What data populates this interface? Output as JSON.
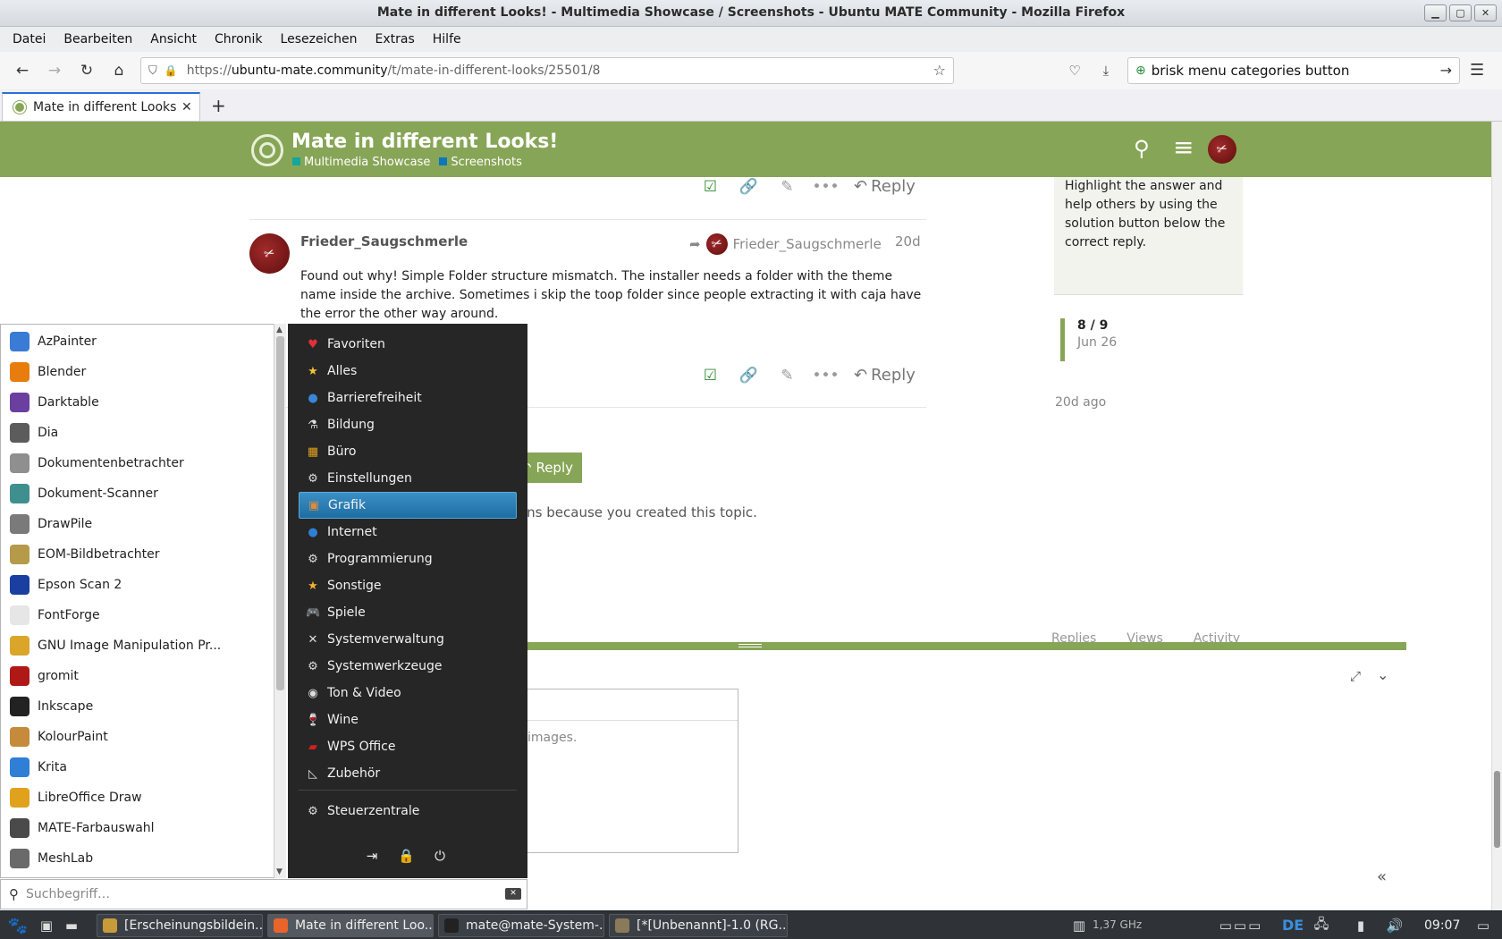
{
  "window": {
    "title": "Mate in different Looks! - Multimedia Showcase / Screenshots - Ubuntu MATE Community - Mozilla Firefox"
  },
  "menubar": {
    "items": [
      "Datei",
      "Bearbeiten",
      "Ansicht",
      "Chronik",
      "Lesezeichen",
      "Extras",
      "Hilfe"
    ]
  },
  "urlbar": {
    "url_prefix": "https://",
    "url_host": "ubuntu-mate.community",
    "url_path": "/t/mate-in-different-looks/25501/8"
  },
  "searchbar": {
    "value": "brisk menu categories button"
  },
  "tabs": [
    {
      "label": "Mate in different Looks!"
    }
  ],
  "topic": {
    "title": "Mate in different Looks!",
    "categories": [
      {
        "name": "Multimedia Showcase",
        "color": "#12a89d"
      },
      {
        "name": "Screenshots",
        "color": "#0e76bd"
      }
    ]
  },
  "post_actions": {
    "reply_label": "Reply"
  },
  "post": {
    "username": "Frieder_Saugschmerle",
    "reply_to": "Frieder_Saugschmerle",
    "date": "20d",
    "body": "Found out why! Simple Folder structure mismatch. The installer needs a folder with the theme name inside the archive. Sometimes i skip the toop folder since people extracting it with caja have the error the other way around."
  },
  "sidebar": {
    "solution_hint": "Highlight the answer and help others by using the solution button below the correct reply.",
    "timeline_position": "8 / 9",
    "timeline_date": "Jun 26",
    "timeline_ago": "20d ago"
  },
  "topic_footer": {
    "reply_button": "Reply",
    "notification_text": "ons because you created this topic.",
    "columns": [
      "Replies",
      "Views",
      "Activity"
    ]
  },
  "composer": {
    "hint": "images."
  },
  "brisk_menu": {
    "apps": [
      {
        "name": "AzPainter",
        "icon": "azpainter-icon",
        "color": "#3a7bd5"
      },
      {
        "name": "Blender",
        "icon": "blender-icon",
        "color": "#e87d0d"
      },
      {
        "name": "Darktable",
        "icon": "darktable-icon",
        "color": "#6a3fa0"
      },
      {
        "name": "Dia",
        "icon": "dia-icon",
        "color": "#5c5c5c"
      },
      {
        "name": "Dokumentenbetrachter",
        "icon": "document-viewer-icon",
        "color": "#8f8f8f"
      },
      {
        "name": "Dokument-Scanner",
        "icon": "scanner-icon",
        "color": "#3f8f8f"
      },
      {
        "name": "DrawPile",
        "icon": "drawpile-icon",
        "color": "#7a7a7a"
      },
      {
        "name": "EOM-Bildbetrachter",
        "icon": "image-viewer-icon",
        "color": "#b59a4a"
      },
      {
        "name": "Epson Scan 2",
        "icon": "epson-scan-icon",
        "color": "#1a3fa0"
      },
      {
        "name": "FontForge",
        "icon": "fontforge-icon",
        "color": "#e6e6e6"
      },
      {
        "name": "GNU Image Manipulation Pr...",
        "icon": "gimp-icon",
        "color": "#d9a62a"
      },
      {
        "name": "gromit",
        "icon": "gromit-icon",
        "color": "#b01818"
      },
      {
        "name": "Inkscape",
        "icon": "inkscape-icon",
        "color": "#222222"
      },
      {
        "name": "KolourPaint",
        "icon": "kolourpaint-icon",
        "color": "#c58a3a"
      },
      {
        "name": "Krita",
        "icon": "krita-icon",
        "color": "#2f7fd6"
      },
      {
        "name": "LibreOffice Draw",
        "icon": "libreoffice-draw-icon",
        "color": "#e0a21c"
      },
      {
        "name": "MATE-Farbauswahl",
        "icon": "color-picker-icon",
        "color": "#4a4a4a"
      },
      {
        "name": "MeshLab",
        "icon": "meshlab-icon",
        "color": "#6a6a6a"
      }
    ],
    "categories": [
      {
        "name": "Favoriten",
        "icon": "heart-icon",
        "glyph": "♥",
        "color": "#e0303a"
      },
      {
        "name": "Alles",
        "icon": "star-icon",
        "glyph": "★",
        "color": "#f2c12e"
      },
      {
        "name": "Barrierefreiheit",
        "icon": "accessibility-icon",
        "glyph": "●",
        "color": "#3a86d6"
      },
      {
        "name": "Bildung",
        "icon": "education-icon",
        "glyph": "⚗",
        "color": "#dddddd"
      },
      {
        "name": "Büro",
        "icon": "office-icon",
        "glyph": "▦",
        "color": "#e0a21c"
      },
      {
        "name": "Einstellungen",
        "icon": "settings-icon",
        "glyph": "⚙",
        "color": "#dddddd"
      },
      {
        "name": "Grafik",
        "icon": "graphics-icon",
        "glyph": "▣",
        "color": "#e08a3a"
      },
      {
        "name": "Internet",
        "icon": "globe-icon",
        "glyph": "●",
        "color": "#2f7fd6"
      },
      {
        "name": "Programmierung",
        "icon": "programming-icon",
        "glyph": "⚙",
        "color": "#dddddd"
      },
      {
        "name": "Sonstige",
        "icon": "other-icon",
        "glyph": "★",
        "color": "#f2b12e"
      },
      {
        "name": "Spiele",
        "icon": "gamepad-icon",
        "glyph": "🎮",
        "color": "#cccccc"
      },
      {
        "name": "Systemverwaltung",
        "icon": "admin-tools-icon",
        "glyph": "✕",
        "color": "#dddddd"
      },
      {
        "name": "Systemwerkzeuge",
        "icon": "system-tools-icon",
        "glyph": "⚙",
        "color": "#dddddd"
      },
      {
        "name": "Ton & Video",
        "icon": "multimedia-icon",
        "glyph": "◉",
        "color": "#dddddd"
      },
      {
        "name": "Wine",
        "icon": "wine-icon",
        "glyph": "🍷",
        "color": "#c03030"
      },
      {
        "name": "WPS Office",
        "icon": "wps-office-icon",
        "glyph": "▰",
        "color": "#d02020"
      },
      {
        "name": "Zubehör",
        "icon": "accessories-icon",
        "glyph": "◺",
        "color": "#dddddd"
      }
    ],
    "active_category": "Grafik",
    "control_center": "Steuerzentrale",
    "search_placeholder": "Suchbegriff…"
  },
  "panel": {
    "tasks": [
      {
        "label": "[Erscheinungsbildein...",
        "icon": "appearance-icon",
        "color": "#c89b3a"
      },
      {
        "label": "Mate in different Loo...",
        "icon": "firefox-icon",
        "color": "#e8642a"
      },
      {
        "label": "mate@mate-System-...",
        "icon": "terminal-icon",
        "color": "#222222"
      },
      {
        "label": "[*[Unbenannt]-1.0 (RG...",
        "icon": "gimp-icon",
        "color": "#8a7a5a"
      }
    ],
    "cpu": "1,37 GHz",
    "keyboard_layout": "DE",
    "clock": "09:07"
  }
}
